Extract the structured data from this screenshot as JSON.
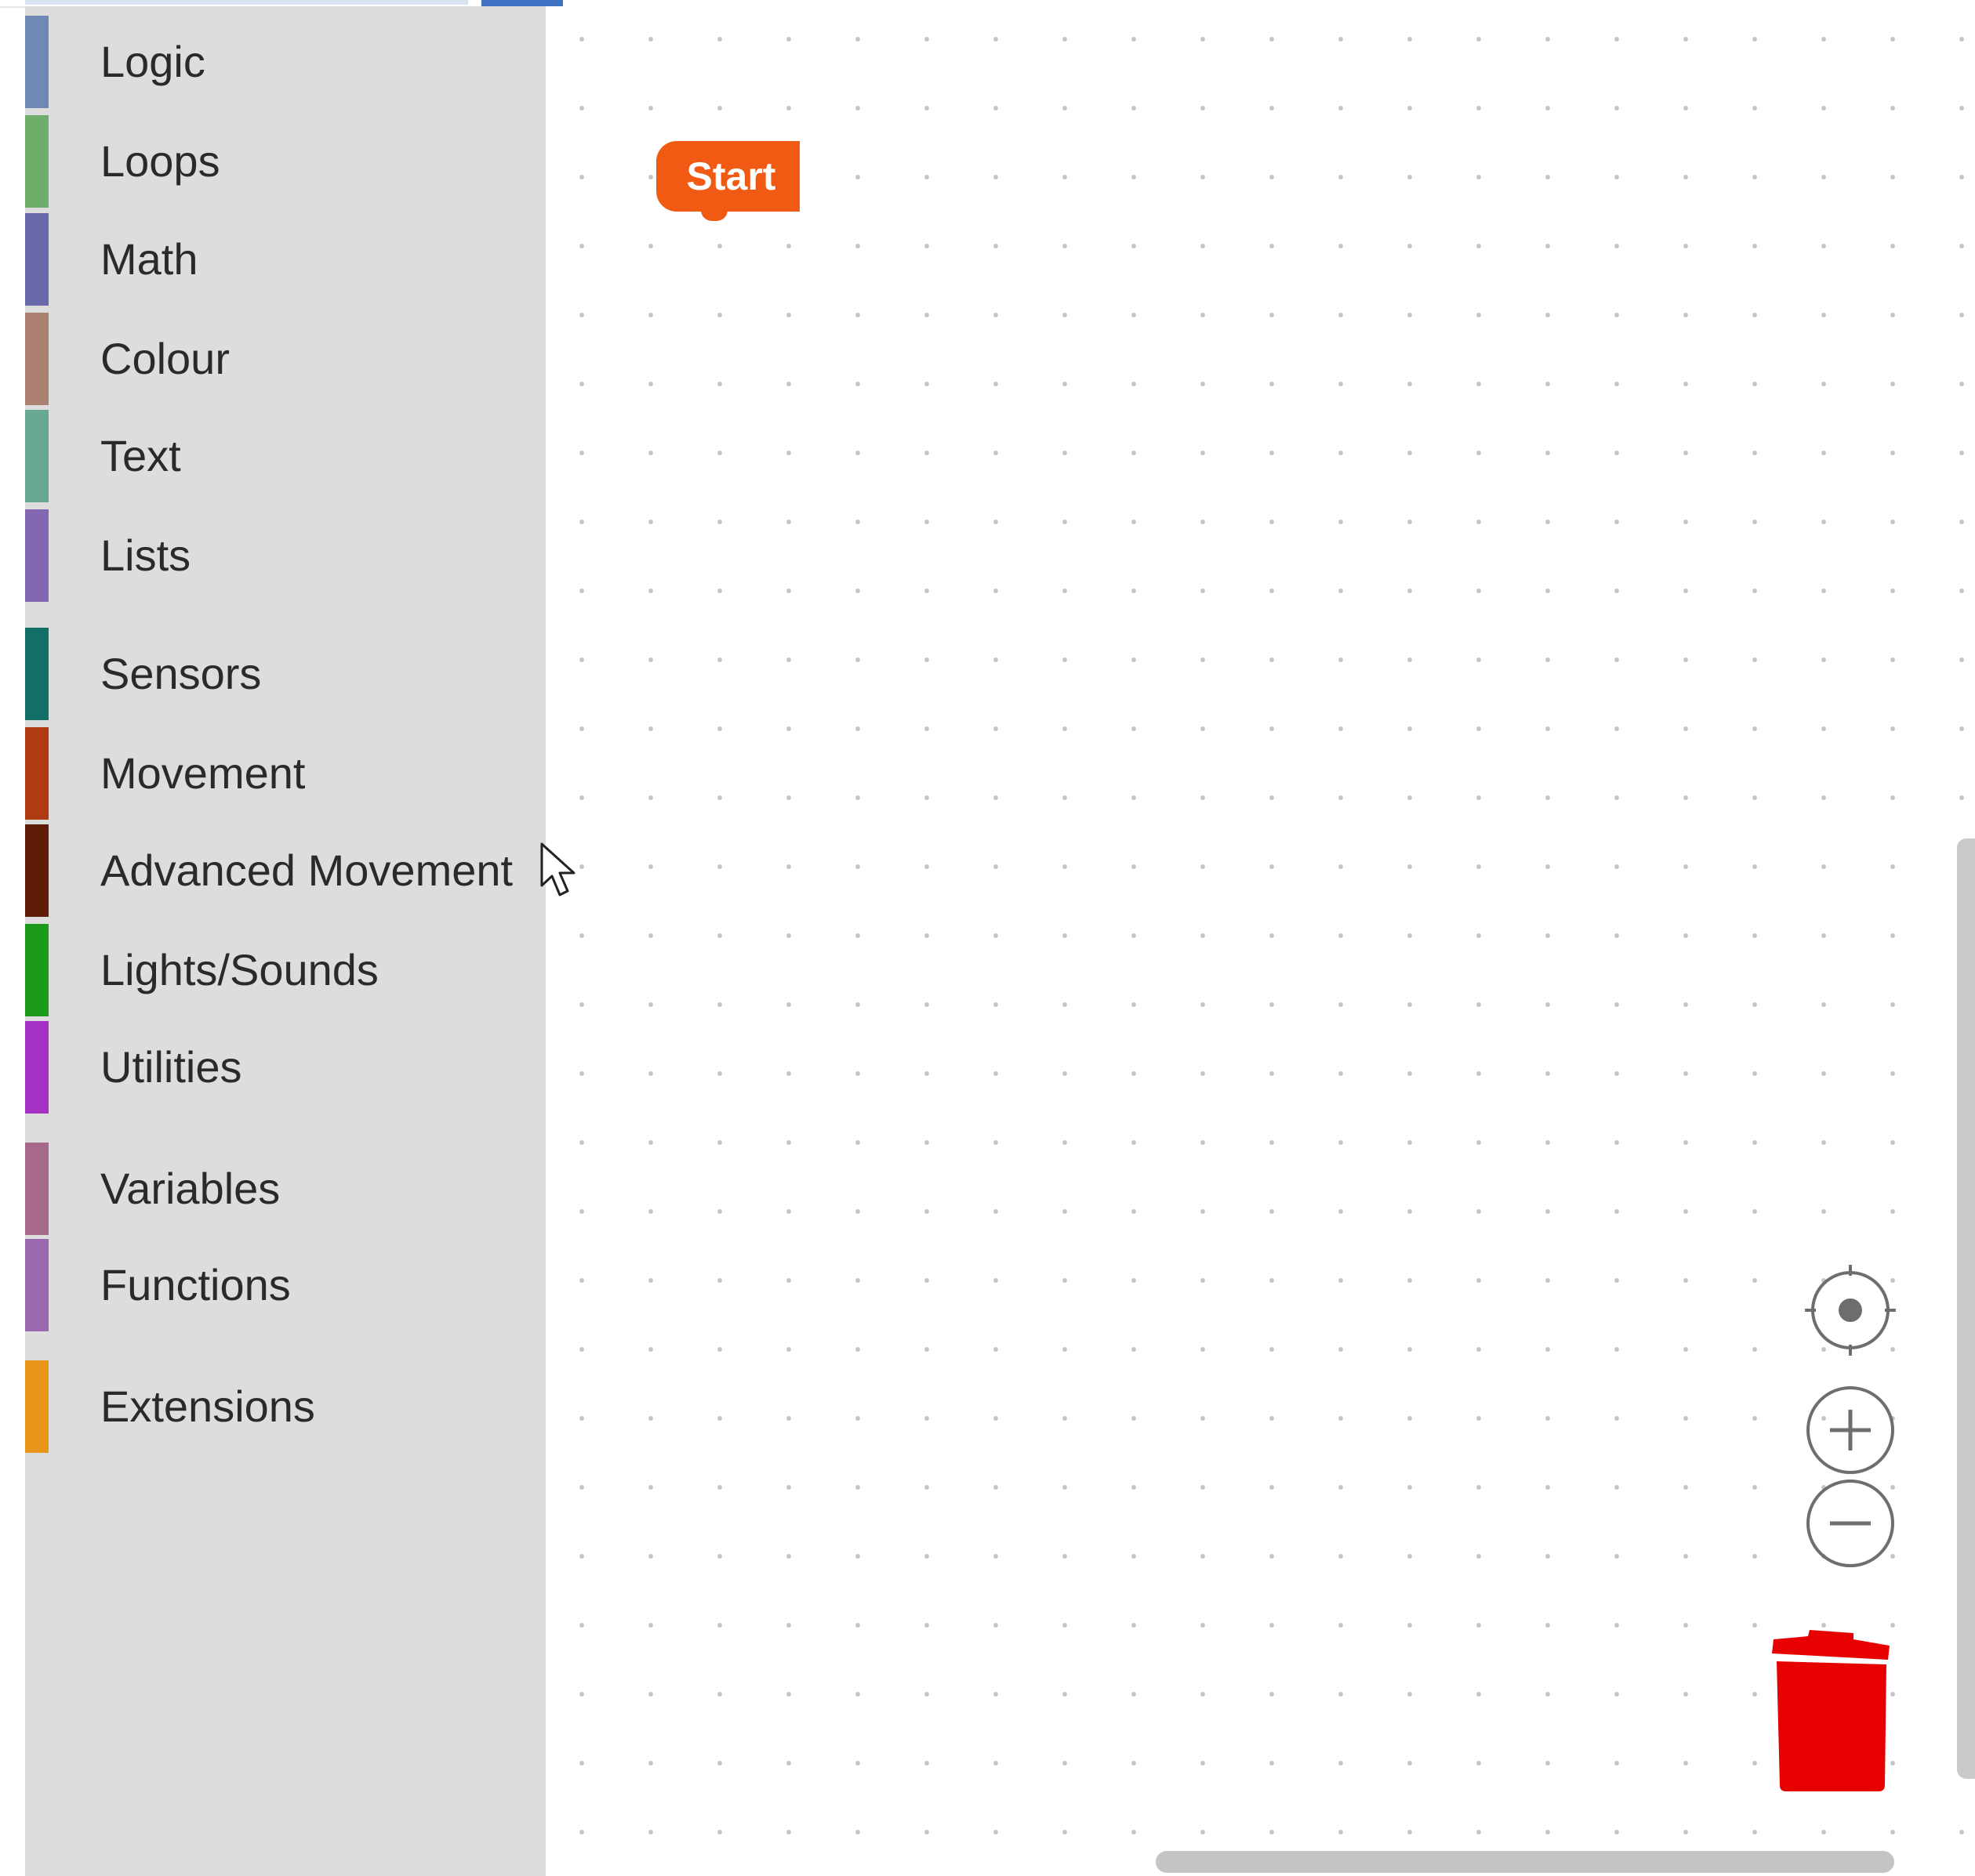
{
  "toolbox": {
    "categories": [
      {
        "label": "Logic",
        "color": "#6f88b4"
      },
      {
        "label": "Loops",
        "color": "#6fae6a"
      },
      {
        "label": "Math",
        "color": "#6a69ac"
      },
      {
        "label": "Colour",
        "color": "#ad8172"
      },
      {
        "label": "Text",
        "color": "#66a892"
      },
      {
        "label": "Lists",
        "color": "#8367b3"
      },
      {
        "label": "Sensors",
        "color": "#136e66"
      },
      {
        "label": "Movement",
        "color": "#ae3b11"
      },
      {
        "label": "Advanced Movement",
        "color": "#5f1c07"
      },
      {
        "label": "Lights/Sounds",
        "color": "#1c9a1c"
      },
      {
        "label": "Utilities",
        "color": "#a532c4"
      },
      {
        "label": "Variables",
        "color": "#a6698a"
      },
      {
        "label": "Functions",
        "color": "#9c68b0"
      },
      {
        "label": "Extensions",
        "color": "#e8951a"
      }
    ]
  },
  "workspace": {
    "start_block": {
      "label": "Start",
      "color": "#f05a12"
    },
    "controls": {
      "recenter_icon": "crosshair-icon",
      "zoom_in_icon": "plus-icon",
      "zoom_out_icon": "minus-icon",
      "trash_icon": "trash-icon",
      "trash_color": "#e60000"
    }
  }
}
